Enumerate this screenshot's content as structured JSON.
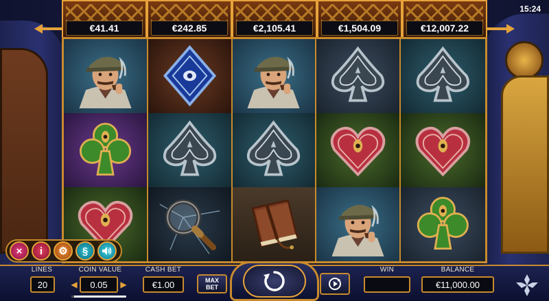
{
  "clock": "15:24",
  "jackpots": [
    "€41.41",
    "€242.85",
    "€2,105.41",
    "€1,504.09",
    "€12,007.22"
  ],
  "reels": [
    [
      {
        "symbol": "detective-icon",
        "bg": "bg-blue"
      },
      {
        "symbol": "club-icon",
        "bg": "bg-purple"
      },
      {
        "symbol": "heart-icon",
        "bg": "bg-green"
      }
    ],
    [
      {
        "symbol": "diamond-icon",
        "bg": "bg-brown"
      },
      {
        "symbol": "spade-icon",
        "bg": "bg-teal"
      },
      {
        "symbol": "magnifier-icon",
        "bg": "bg-dark"
      }
    ],
    [
      {
        "symbol": "detective-icon",
        "bg": "bg-blue"
      },
      {
        "symbol": "spade-icon",
        "bg": "bg-teal"
      },
      {
        "symbol": "journal-icon",
        "bg": "bg-wood"
      }
    ],
    [
      {
        "symbol": "spade-icon",
        "bg": "bg-slate"
      },
      {
        "symbol": "heart-icon",
        "bg": "bg-green"
      },
      {
        "symbol": "detective-icon",
        "bg": "bg-blue"
      }
    ],
    [
      {
        "symbol": "spade-icon",
        "bg": "bg-teal"
      },
      {
        "symbol": "heart-icon",
        "bg": "bg-green"
      },
      {
        "symbol": "club-icon",
        "bg": "bg-slate"
      }
    ]
  ],
  "menu": {
    "close": "×",
    "info": "i",
    "settings": "⚙",
    "rules": "§",
    "sound": "🔊"
  },
  "controls": {
    "lines_label": "LINES",
    "lines_value": "20",
    "coin_label": "COIN VALUE",
    "coin_value": "0.05",
    "cashbet_label": "CASH BET",
    "cashbet_value": "€1.00",
    "maxbet_line1": "MAX",
    "maxbet_line2": "BET",
    "win_label": "WIN",
    "win_value": "",
    "balance_label": "BALANCE",
    "balance_value": "€11,000.00",
    "coin_slider_level": 0.05
  },
  "colors": {
    "frame_gold": "#c98b2c",
    "bar_navy": "#1c2250"
  }
}
